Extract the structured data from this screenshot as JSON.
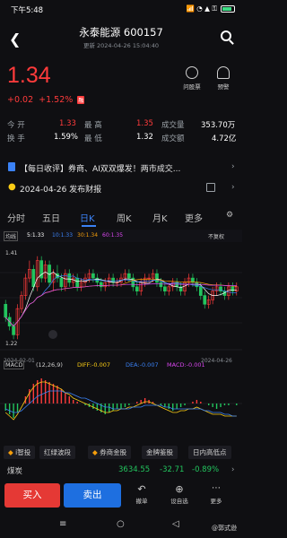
{
  "status_bar": {
    "time": "下午5:48",
    "icons": "📶 ◔ ▲ ⚿",
    "battery": "100"
  },
  "header": {
    "title": "永泰能源 600157",
    "subtitle": "更新 2024-04-26 15:04:40"
  },
  "quote": {
    "price": "1.34",
    "change": "+0.02",
    "change_pct": "+1.52%",
    "badge": "融"
  },
  "tools": [
    {
      "label": "问股票"
    },
    {
      "label": "预警"
    }
  ],
  "stats": {
    "row1": {
      "l1": "今 开",
      "v1": "1.33",
      "l2": "最 高",
      "v2": "1.35",
      "l3": "成交量",
      "v3": "353.70万"
    },
    "row2": {
      "l1": "换 手",
      "v1": "1.59%",
      "l2": "最 低",
      "v2": "1.32",
      "l3": "成交额",
      "v3": "4.72亿"
    }
  },
  "news": [
    {
      "text": "【每日收评】券商、AI双双爆发！两市成交..."
    },
    {
      "text": "2024-04-26 发布财报"
    }
  ],
  "tabs": {
    "items": [
      "分时",
      "五日",
      "日K",
      "周K",
      "月K",
      "更多"
    ],
    "active_index": 2
  },
  "ma_legend": {
    "label": "均线",
    "ma5": "5:1.33",
    "ma10": "10:1.33",
    "ma30": "30:1.34",
    "ma60": "60:1.35",
    "fq": "不复权"
  },
  "colors": {
    "up": "#ff3b3b",
    "down": "#22c55e",
    "accent": "#3b82f6",
    "ma5": "#ffffff",
    "ma10": "#3b82f6",
    "ma30": "#f59e0b",
    "ma60": "#d946ef"
  },
  "chart_data": {
    "type": "candlestick",
    "start_label": "2024-02-01",
    "end_label": "2024-04-26",
    "high_label": "1.41",
    "low_label": "1.22",
    "ylim": [
      1.2,
      1.43
    ],
    "candles": [
      [
        1.3,
        1.31,
        1.26,
        1.27
      ],
      [
        1.27,
        1.28,
        1.24,
        1.25
      ],
      [
        1.25,
        1.26,
        1.22,
        1.23
      ],
      [
        1.23,
        1.3,
        1.22,
        1.29
      ],
      [
        1.29,
        1.33,
        1.28,
        1.32
      ],
      [
        1.32,
        1.37,
        1.31,
        1.36
      ],
      [
        1.36,
        1.4,
        1.35,
        1.38
      ],
      [
        1.38,
        1.39,
        1.33,
        1.34
      ],
      [
        1.34,
        1.41,
        1.33,
        1.4
      ],
      [
        1.4,
        1.41,
        1.35,
        1.36
      ],
      [
        1.36,
        1.4,
        1.35,
        1.39
      ],
      [
        1.39,
        1.4,
        1.34,
        1.35
      ],
      [
        1.35,
        1.38,
        1.33,
        1.37
      ],
      [
        1.37,
        1.39,
        1.35,
        1.36
      ],
      [
        1.36,
        1.37,
        1.33,
        1.34
      ],
      [
        1.34,
        1.38,
        1.33,
        1.37
      ],
      [
        1.37,
        1.38,
        1.34,
        1.35
      ],
      [
        1.35,
        1.37,
        1.34,
        1.36
      ],
      [
        1.36,
        1.37,
        1.33,
        1.34
      ],
      [
        1.34,
        1.36,
        1.33,
        1.35
      ],
      [
        1.35,
        1.37,
        1.34,
        1.36
      ],
      [
        1.36,
        1.38,
        1.35,
        1.37
      ],
      [
        1.37,
        1.38,
        1.35,
        1.36
      ],
      [
        1.36,
        1.37,
        1.34,
        1.35
      ],
      [
        1.35,
        1.36,
        1.33,
        1.34
      ],
      [
        1.34,
        1.36,
        1.33,
        1.35
      ],
      [
        1.35,
        1.37,
        1.34,
        1.36
      ],
      [
        1.36,
        1.37,
        1.34,
        1.35
      ],
      [
        1.35,
        1.36,
        1.34,
        1.35
      ],
      [
        1.35,
        1.37,
        1.34,
        1.36
      ],
      [
        1.36,
        1.38,
        1.35,
        1.37
      ],
      [
        1.37,
        1.38,
        1.35,
        1.36
      ],
      [
        1.36,
        1.37,
        1.33,
        1.34
      ],
      [
        1.34,
        1.35,
        1.32,
        1.33
      ],
      [
        1.33,
        1.36,
        1.32,
        1.35
      ],
      [
        1.35,
        1.37,
        1.34,
        1.36
      ],
      [
        1.36,
        1.37,
        1.35,
        1.36
      ],
      [
        1.36,
        1.38,
        1.35,
        1.37
      ],
      [
        1.37,
        1.38,
        1.34,
        1.35
      ],
      [
        1.35,
        1.36,
        1.33,
        1.34
      ],
      [
        1.34,
        1.35,
        1.32,
        1.33
      ],
      [
        1.33,
        1.35,
        1.32,
        1.34
      ],
      [
        1.34,
        1.36,
        1.33,
        1.35
      ],
      [
        1.35,
        1.36,
        1.33,
        1.34
      ],
      [
        1.34,
        1.35,
        1.32,
        1.33
      ],
      [
        1.33,
        1.36,
        1.32,
        1.35
      ],
      [
        1.35,
        1.37,
        1.34,
        1.36
      ],
      [
        1.36,
        1.37,
        1.34,
        1.35
      ],
      [
        1.35,
        1.36,
        1.33,
        1.34
      ],
      [
        1.34,
        1.35,
        1.31,
        1.32
      ],
      [
        1.32,
        1.33,
        1.29,
        1.3
      ],
      [
        1.3,
        1.32,
        1.29,
        1.31
      ],
      [
        1.31,
        1.34,
        1.3,
        1.33
      ],
      [
        1.33,
        1.35,
        1.32,
        1.34
      ],
      [
        1.34,
        1.35,
        1.32,
        1.33
      ],
      [
        1.33,
        1.34,
        1.31,
        1.32
      ],
      [
        1.32,
        1.35,
        1.31,
        1.34
      ],
      [
        1.34,
        1.35,
        1.32,
        1.33
      ],
      [
        1.33,
        1.35,
        1.32,
        1.34
      ]
    ]
  },
  "macd": {
    "label": "MACD",
    "params": "(12,26,9)",
    "diff": "DIFF:-0.007",
    "dea": "DEA:-0.007",
    "macd": "MACD:-0.001",
    "hist": [
      -0.004,
      -0.006,
      -0.008,
      -0.005,
      0.0,
      0.004,
      0.008,
      0.011,
      0.013,
      0.014,
      0.013,
      0.012,
      0.011,
      0.01,
      0.008,
      0.006,
      0.004,
      0.002,
      0.001,
      0.0,
      -0.001,
      -0.002,
      -0.003,
      -0.004,
      -0.005,
      -0.006,
      -0.005,
      -0.004,
      -0.003,
      -0.003,
      -0.002,
      -0.001,
      0.0,
      0.001,
      0.002,
      0.003,
      0.002,
      0.001,
      0.0,
      -0.001,
      -0.002,
      -0.003,
      -0.004,
      -0.003,
      -0.002,
      -0.001,
      0.0,
      0.001,
      0.002,
      0.001,
      0.0,
      -0.001,
      -0.002,
      -0.003,
      -0.002,
      -0.001,
      -0.001,
      0.0,
      -0.001
    ],
    "dif_line": [
      -0.005,
      -0.007,
      -0.009,
      -0.006,
      -0.002,
      0.002,
      0.006,
      0.009,
      0.011,
      0.012,
      0.012,
      0.011,
      0.01,
      0.009,
      0.008,
      0.006,
      0.005,
      0.003,
      0.002,
      0.001,
      0.0,
      -0.001,
      -0.002,
      -0.003,
      -0.004,
      -0.005,
      -0.005,
      -0.004,
      -0.004,
      -0.003,
      -0.003,
      -0.002,
      -0.002,
      -0.001,
      0.0,
      0.001,
      0.001,
      0.0,
      -0.001,
      -0.002,
      -0.003,
      -0.004,
      -0.005,
      -0.005,
      -0.004,
      -0.004,
      -0.003,
      -0.003,
      -0.002,
      -0.003,
      -0.004,
      -0.005,
      -0.006,
      -0.006,
      -0.006,
      -0.007,
      -0.007,
      -0.007,
      -0.007
    ],
    "dea_line": [
      -0.003,
      -0.004,
      -0.005,
      -0.005,
      -0.004,
      -0.002,
      0.0,
      0.002,
      0.004,
      0.005,
      0.006,
      0.007,
      0.007,
      0.007,
      0.007,
      0.006,
      0.006,
      0.005,
      0.004,
      0.003,
      0.003,
      0.002,
      0.001,
      0.0,
      -0.001,
      -0.002,
      -0.002,
      -0.003,
      -0.003,
      -0.003,
      -0.003,
      -0.003,
      -0.002,
      -0.002,
      -0.002,
      -0.001,
      -0.001,
      -0.001,
      -0.001,
      -0.001,
      -0.002,
      -0.002,
      -0.003,
      -0.003,
      -0.003,
      -0.003,
      -0.003,
      -0.003,
      -0.003,
      -0.003,
      -0.004,
      -0.004,
      -0.005,
      -0.005,
      -0.005,
      -0.006,
      -0.006,
      -0.007,
      -0.007
    ]
  },
  "chips": [
    "i智投",
    "红绿波段",
    "券商金股",
    "金牌鉴股",
    "日内高低点"
  ],
  "index_row": {
    "name": "煤炭",
    "value": "3634.55",
    "change": "-32.71",
    "pct": "-0.89%"
  },
  "actions": {
    "buy": "买入",
    "sell": "卖出",
    "cancel": "撤单",
    "self": "设自选",
    "more": "更多"
  },
  "navbar": {
    "menu": "≡",
    "home": "○",
    "back": "◁"
  },
  "watermark": "@郭式逊"
}
